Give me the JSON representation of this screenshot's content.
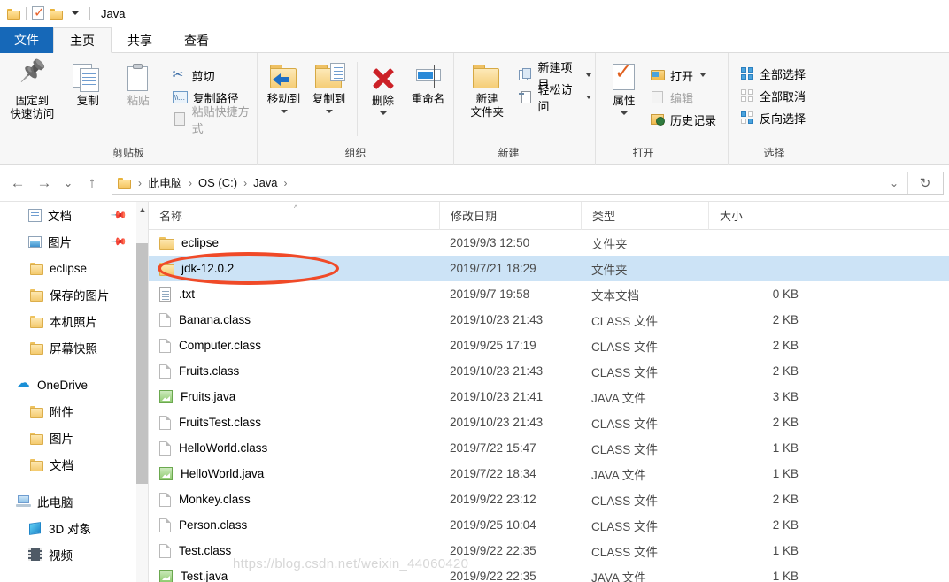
{
  "titlebar": {
    "title": "Java",
    "quick_access": [
      "folder-icon",
      "checked-document-icon",
      "folder-icon"
    ],
    "dropdown_icon": "chevron-down-icon"
  },
  "tabs": [
    {
      "label": "文件",
      "active": false,
      "style": "file"
    },
    {
      "label": "主页",
      "active": true
    },
    {
      "label": "共享",
      "active": false
    },
    {
      "label": "查看",
      "active": false
    }
  ],
  "ribbon": {
    "groups": [
      {
        "label": "剪贴板",
        "big": [
          {
            "label": "固定到\n快速访问",
            "icon": "pin-icon",
            "disabled": false
          },
          {
            "label": "复制",
            "icon": "copy-icon",
            "disabled": false
          },
          {
            "label": "粘贴",
            "icon": "paste-icon",
            "disabled": true
          }
        ],
        "small": [
          {
            "label": "剪切",
            "icon": "scissors-icon",
            "disabled": false
          },
          {
            "label": "复制路径",
            "icon": "copy-path-icon",
            "disabled": false
          },
          {
            "label": "粘贴快捷方式",
            "icon": "paste-shortcut-icon",
            "disabled": true
          }
        ]
      },
      {
        "label": "组织",
        "big": [
          {
            "label": "移动到",
            "icon": "move-to-icon",
            "caret": true
          },
          {
            "label": "复制到",
            "icon": "copy-to-icon",
            "caret": true
          },
          {
            "label": "删除",
            "icon": "delete-icon",
            "caret": true
          },
          {
            "label": "重命名",
            "icon": "rename-icon",
            "caret": false
          }
        ]
      },
      {
        "label": "新建",
        "big": [
          {
            "label": "新建\n文件夹",
            "icon": "new-folder-icon",
            "caret": false
          }
        ],
        "small": [
          {
            "label": "新建项目",
            "icon": "new-item-icon",
            "caret": true
          },
          {
            "label": "轻松访问",
            "icon": "easy-access-icon",
            "caret": true
          }
        ]
      },
      {
        "label": "打开",
        "big": [
          {
            "label": "属性",
            "icon": "properties-icon",
            "caret": true
          }
        ],
        "small": [
          {
            "label": "打开",
            "icon": "open-icon",
            "caret": true
          },
          {
            "label": "编辑",
            "icon": "edit-icon",
            "disabled": true
          },
          {
            "label": "历史记录",
            "icon": "history-icon"
          }
        ]
      },
      {
        "label": "选择",
        "small": [
          {
            "label": "全部选择",
            "icon": "select-all-icon"
          },
          {
            "label": "全部取消",
            "icon": "select-none-icon"
          },
          {
            "label": "反向选择",
            "icon": "invert-selection-icon"
          }
        ]
      }
    ]
  },
  "addressbar": {
    "back_icon": "arrow-left-icon",
    "forward_icon": "arrow-right-icon",
    "recent_icon": "chevron-down-icon",
    "up_icon": "arrow-up-icon",
    "path_icon": "folder-icon",
    "crumbs": [
      "此电脑",
      "OS (C:)",
      "Java"
    ],
    "separator": "›",
    "dropdown_icon": "chevron-down-icon",
    "refresh_icon": "refresh-icon"
  },
  "sidebar": {
    "items": [
      {
        "label": "文档",
        "icon": "document-icon",
        "pinned": true,
        "indent": 1
      },
      {
        "label": "图片",
        "icon": "picture-icon",
        "pinned": true,
        "indent": 1
      },
      {
        "label": "eclipse",
        "icon": "folder-icon",
        "indent": 1
      },
      {
        "label": "保存的图片",
        "icon": "folder-icon",
        "indent": 1
      },
      {
        "label": "本机照片",
        "icon": "folder-icon",
        "indent": 1
      },
      {
        "label": "屏幕快照",
        "icon": "folder-icon",
        "indent": 1
      },
      {
        "label": "OneDrive",
        "icon": "cloud-icon",
        "indent": 0,
        "spaced": true
      },
      {
        "label": "附件",
        "icon": "folder-icon",
        "indent": 1
      },
      {
        "label": "图片",
        "icon": "folder-icon",
        "indent": 1
      },
      {
        "label": "文档",
        "icon": "folder-icon",
        "indent": 1
      },
      {
        "label": "此电脑",
        "icon": "this-pc-icon",
        "indent": 0,
        "spaced": true
      },
      {
        "label": "3D 对象",
        "icon": "3d-objects-icon",
        "indent": 1
      },
      {
        "label": "视频",
        "icon": "videos-icon",
        "indent": 1
      }
    ],
    "scrollbar": {
      "up_arrow": "chevron-up-icon"
    }
  },
  "filelist": {
    "columns": [
      "名称",
      "修改日期",
      "类型",
      "大小"
    ],
    "sorted_column": "名称",
    "sort_indicator": "^",
    "rows": [
      {
        "name": "eclipse",
        "icon": "folder-icon",
        "date": "2019/9/3 12:50",
        "type": "文件夹",
        "size": "",
        "selected": false
      },
      {
        "name": "jdk-12.0.2",
        "icon": "folder-icon",
        "date": "2019/7/21 18:29",
        "type": "文件夹",
        "size": "",
        "selected": true
      },
      {
        "name": ".txt",
        "icon": "text-file-icon",
        "date": "2019/9/7 19:58",
        "type": "文本文档",
        "size": "0 KB",
        "selected": false
      },
      {
        "name": "Banana.class",
        "icon": "generic-file-icon",
        "date": "2019/10/23 21:43",
        "type": "CLASS 文件",
        "size": "2 KB",
        "selected": false
      },
      {
        "name": "Computer.class",
        "icon": "generic-file-icon",
        "date": "2019/9/25 17:19",
        "type": "CLASS 文件",
        "size": "2 KB",
        "selected": false
      },
      {
        "name": "Fruits.class",
        "icon": "generic-file-icon",
        "date": "2019/10/23 21:43",
        "type": "CLASS 文件",
        "size": "2 KB",
        "selected": false
      },
      {
        "name": "Fruits.java",
        "icon": "java-file-icon",
        "date": "2019/10/23 21:41",
        "type": "JAVA 文件",
        "size": "3 KB",
        "selected": false
      },
      {
        "name": "FruitsTest.class",
        "icon": "generic-file-icon",
        "date": "2019/10/23 21:43",
        "type": "CLASS 文件",
        "size": "2 KB",
        "selected": false
      },
      {
        "name": "HelloWorld.class",
        "icon": "generic-file-icon",
        "date": "2019/7/22 15:47",
        "type": "CLASS 文件",
        "size": "1 KB",
        "selected": false
      },
      {
        "name": "HelloWorld.java",
        "icon": "java-file-icon",
        "date": "2019/7/22 18:34",
        "type": "JAVA 文件",
        "size": "1 KB",
        "selected": false
      },
      {
        "name": "Monkey.class",
        "icon": "generic-file-icon",
        "date": "2019/9/22 23:12",
        "type": "CLASS 文件",
        "size": "2 KB",
        "selected": false
      },
      {
        "name": "Person.class",
        "icon": "generic-file-icon",
        "date": "2019/9/25 10:04",
        "type": "CLASS 文件",
        "size": "2 KB",
        "selected": false
      },
      {
        "name": "Test.class",
        "icon": "generic-file-icon",
        "date": "2019/9/22 22:35",
        "type": "CLASS 文件",
        "size": "1 KB",
        "selected": false
      },
      {
        "name": "Test.java",
        "icon": "java-file-icon",
        "date": "2019/9/22 22:35",
        "type": "JAVA 文件",
        "size": "1 KB",
        "selected": false
      }
    ]
  },
  "annotation": {
    "shape": "ellipse",
    "color": "#f04a28",
    "target": "jdk-12.0.2"
  },
  "watermark": {
    "text": "https://blog.csdn.net/weixin_44060420"
  },
  "colors": {
    "accent": "#1668b8",
    "selection": "#cce3f6",
    "annotation": "#f04a28"
  }
}
